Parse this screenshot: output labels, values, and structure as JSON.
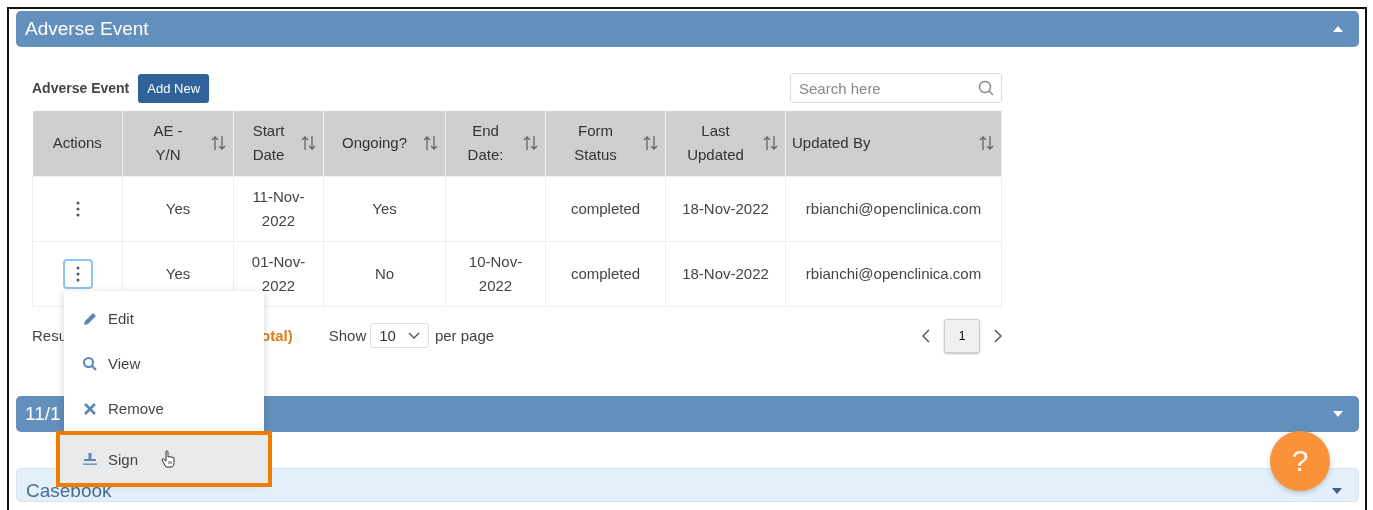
{
  "panels": [
    {
      "title": "Adverse Event",
      "kind": "primary",
      "expanded": true
    },
    {
      "title": "11/1",
      "kind": "primary",
      "expanded": false
    },
    {
      "title": "Casebook",
      "kind": "light",
      "expanded": false
    }
  ],
  "table_section": {
    "label": "Adverse Event",
    "add_button": "Add New",
    "search": {
      "placeholder": "Search here"
    }
  },
  "table": {
    "columns": [
      {
        "label": "Actions",
        "sortable": false
      },
      {
        "label": "AE -\nY/N",
        "sortable": true
      },
      {
        "label": "Start\nDate",
        "sortable": true
      },
      {
        "label": "Ongoing?",
        "sortable": true
      },
      {
        "label": "End\nDate:",
        "sortable": true
      },
      {
        "label": "Form\nStatus",
        "sortable": true
      },
      {
        "label": "Last\nUpdated",
        "sortable": true
      },
      {
        "label": "Updated By",
        "sortable": true
      }
    ],
    "rows": [
      {
        "focused": false,
        "cells": [
          "",
          "Yes",
          "11-Nov-\n2022",
          "Yes",
          "",
          "completed",
          "18-Nov-2022",
          "rbianchi@openclinica.com"
        ]
      },
      {
        "focused": true,
        "cells": [
          "",
          "Yes",
          "01-Nov-\n2022",
          "No",
          "10-Nov-\n2022",
          "completed",
          "18-Nov-2022",
          "rbianchi@openclinica.com"
        ]
      }
    ]
  },
  "footer": {
    "results_start": "Resu",
    "results_end": "otal)",
    "show_label": "Show",
    "page_size": "10",
    "per_page": "per page",
    "pages": [
      {
        "label": "1",
        "selected": true
      }
    ]
  },
  "menu": {
    "items": [
      {
        "label": "Edit",
        "kind": "edit",
        "hovered": false
      },
      {
        "label": "View",
        "kind": "view",
        "hovered": false
      },
      {
        "label": "Remove",
        "kind": "remove",
        "hovered": false
      },
      {
        "label": "Sign",
        "kind": "sign",
        "hovered": true
      }
    ]
  },
  "help_button": {
    "label": "?"
  }
}
